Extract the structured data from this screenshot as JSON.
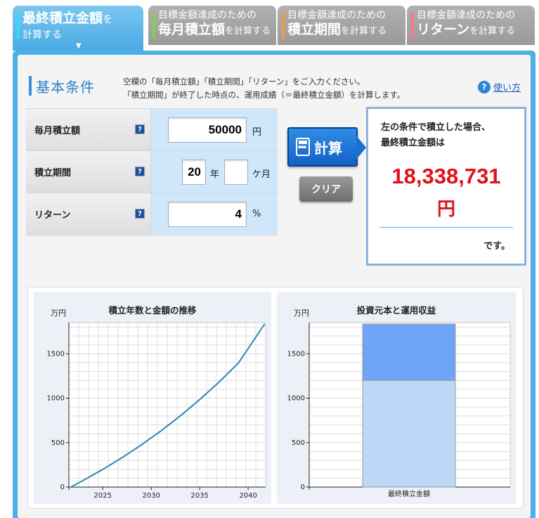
{
  "tabs": [
    {
      "line1_big": "最終積立金額",
      "line1_small": "を",
      "line2": "計算する",
      "color": "#5bb4ea",
      "active": true
    },
    {
      "line1": "目標金額達成のための",
      "big": "毎月積立額",
      "small": "を計算する",
      "stripe": "#7fd44a"
    },
    {
      "line1": "目標金額達成のための",
      "big": "積立期間",
      "small": "を計算する",
      "stripe": "#f29a4a"
    },
    {
      "line1": "目標金額達成のための",
      "big": "リターン",
      "small": "を計算する",
      "stripe": "#f07c8a"
    }
  ],
  "section": {
    "title": "基本条件",
    "desc_line1": "空欄の「毎月積立額」「積立期間」「リターン」をご入力ください。",
    "desc_line2": "「積立期間」が終了した時点の、運用成績（＝最終積立金額）を計算します。",
    "howto": "使い方",
    "howto_icon": "?"
  },
  "form": {
    "monthly_label": "毎月積立額",
    "monthly_value": "50000",
    "monthly_unit": "円",
    "period_label": "積立期間",
    "years_value": "20",
    "years_unit": "年",
    "months_value": "",
    "months_unit": "ケ月",
    "return_label": "リターン",
    "return_value": "4",
    "return_unit": "%",
    "help_glyph": "?"
  },
  "buttons": {
    "calc": "計算",
    "clear": "クリア"
  },
  "result": {
    "line1": "左の条件で積立した場合、",
    "line2": "最終積立金額は",
    "amount": "18,338,731",
    "yen": "円",
    "desu": "です。",
    "amount_color": "#e0131a"
  },
  "chart_data": [
    {
      "type": "line",
      "title": "積立年数と金額の推移",
      "ylabel": "万円",
      "ylim": [
        0,
        1850
      ],
      "xlim": [
        2021.5,
        2041.8
      ],
      "xticks": [
        2025,
        2030,
        2035,
        2040
      ],
      "yticks": [
        0,
        500,
        1000,
        1500
      ],
      "series": [
        {
          "x": [
            2021.7,
            2023,
            2025,
            2027,
            2029,
            2031,
            2033,
            2035,
            2037,
            2039,
            2041.7
          ],
          "values": [
            0,
            76,
            199,
            332,
            476,
            632,
            801,
            984,
            1182,
            1397,
            1834
          ],
          "color": "#2b88b0"
        }
      ]
    },
    {
      "type": "bar",
      "title": "投資元本と運用収益",
      "ylabel": "万円",
      "ylim": [
        0,
        1850
      ],
      "yticks": [
        0,
        500,
        1000,
        1500
      ],
      "categories": [
        "最終積立金額"
      ],
      "series": [
        {
          "values": [
            1200
          ],
          "color": "#bcd8f6"
        },
        {
          "values": [
            634
          ],
          "color": "#6fa4f6"
        }
      ]
    }
  ]
}
